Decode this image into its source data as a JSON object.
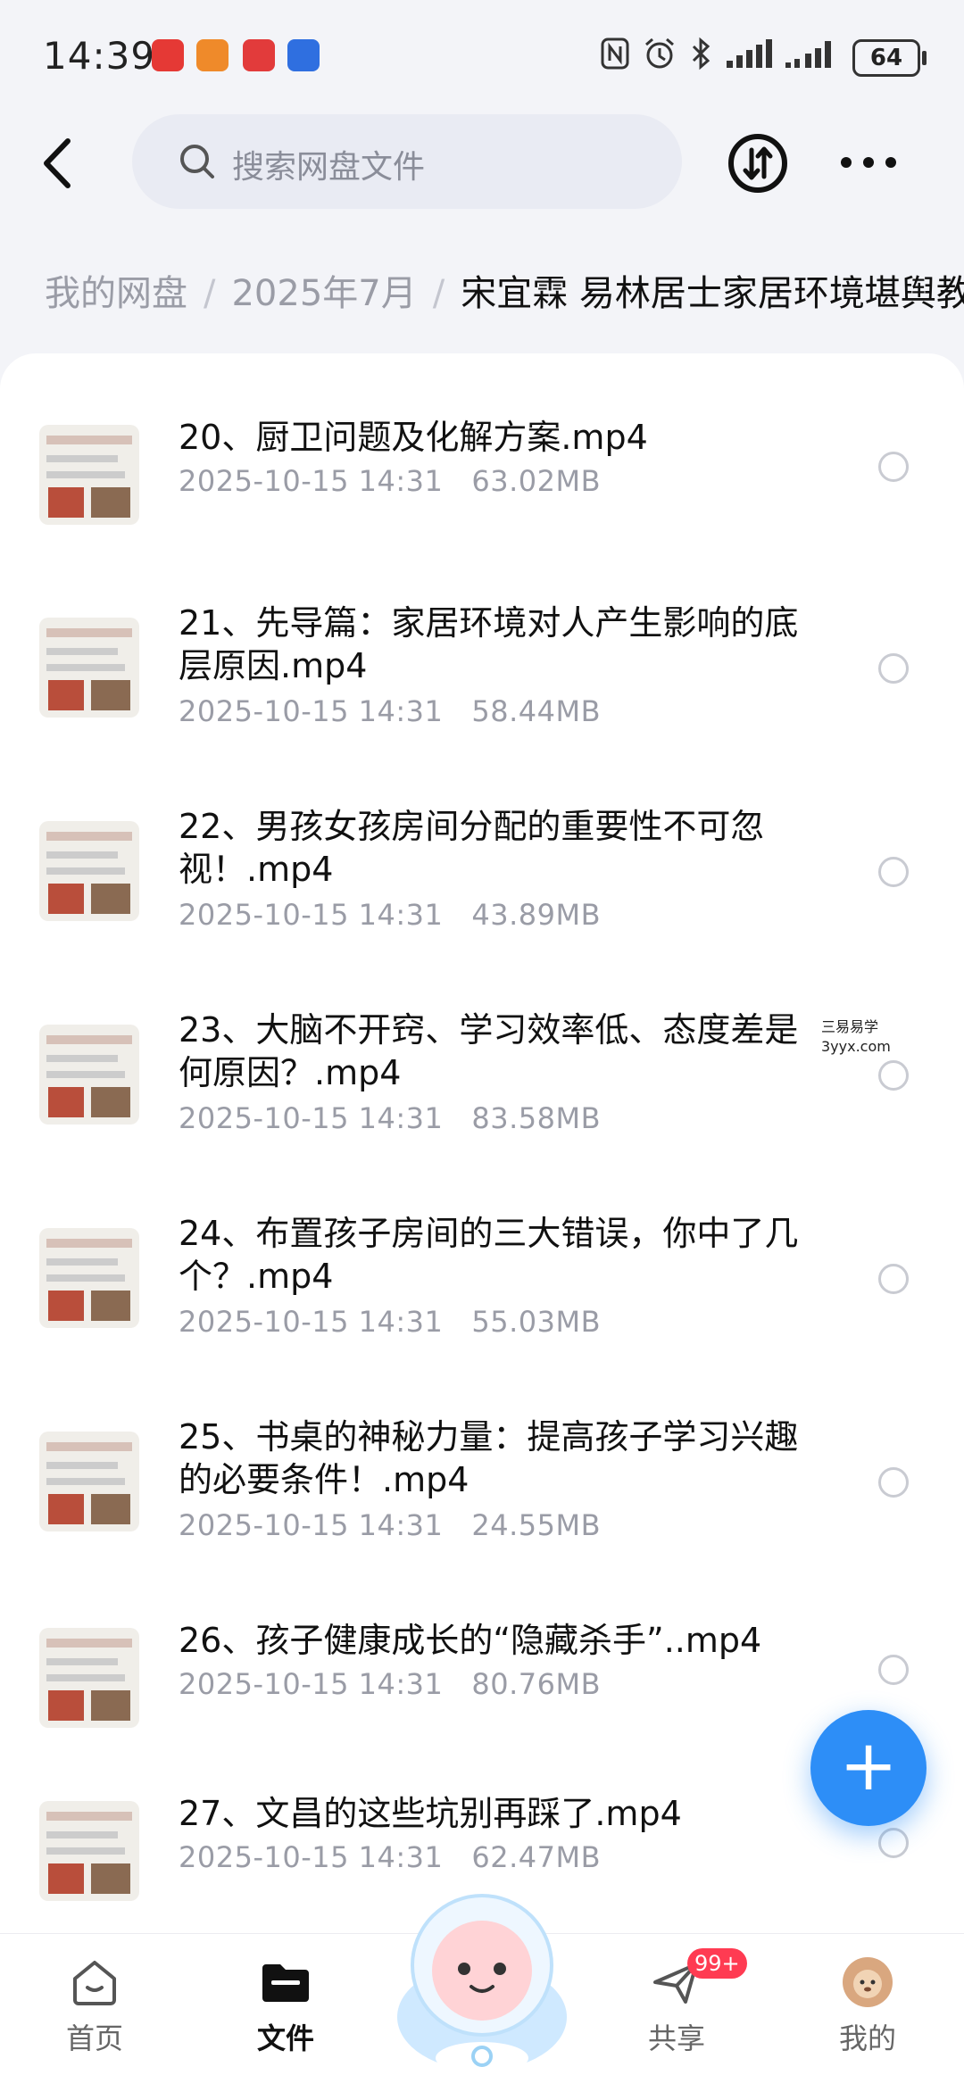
{
  "status_bar": {
    "time": "14:39",
    "battery": "64",
    "app_icons": [
      "#e53935",
      "#ef8a2a",
      "#e23b3b",
      "#2f6fe0"
    ]
  },
  "header": {
    "search_placeholder": "搜索网盘文件"
  },
  "breadcrumb": {
    "items": [
      "我的网盘",
      "2025年7月",
      "宋宜霖 易林居士家居环境堪舆教学"
    ]
  },
  "files": [
    {
      "title": "20、厨卫问题及化解方案.mp4",
      "date": "2025-10-15  14:31",
      "size": "63.02MB"
    },
    {
      "title": "21、先导篇：家居环境对人产生影响的底层原因.mp4",
      "date": "2025-10-15  14:31",
      "size": "58.44MB"
    },
    {
      "title": "22、男孩女孩房间分配的重要性不可忽视！.mp4",
      "date": "2025-10-15  14:31",
      "size": "43.89MB"
    },
    {
      "title": "23、大脑不开窍、学习效率低、态度差是何原因？.mp4",
      "date": "2025-10-15  14:31",
      "size": "83.58MB"
    },
    {
      "title": "24、布置孩子房间的三大错误，你中了几个？.mp4",
      "date": "2025-10-15  14:31",
      "size": "55.03MB"
    },
    {
      "title": "25、书桌的神秘力量：提高孩子学习兴趣的必要条件！.mp4",
      "date": "2025-10-15  14:31",
      "size": "24.55MB"
    },
    {
      "title": "26、孩子健康成长的“隐藏杀手”..mp4",
      "date": "2025-10-15  14:31",
      "size": "80.76MB"
    },
    {
      "title": "27、文昌的这些坑别再踩了.mp4",
      "date": "2025-10-15  14:31",
      "size": "62.47MB"
    }
  ],
  "watermark": {
    "line1": "三易易学",
    "line2": "3yyx.com"
  },
  "fab": {
    "label": "+"
  },
  "tabs": [
    {
      "label": "首页",
      "icon": "home-icon"
    },
    {
      "label": "文件",
      "icon": "folder-icon"
    },
    {
      "label": "共享",
      "icon": "send-icon",
      "badge": "99+"
    },
    {
      "label": "我的",
      "icon": "avatar-icon"
    }
  ],
  "colors": {
    "accent": "#2d8ef7",
    "badge": "#ff3b52",
    "background": "#f3f4f8"
  }
}
